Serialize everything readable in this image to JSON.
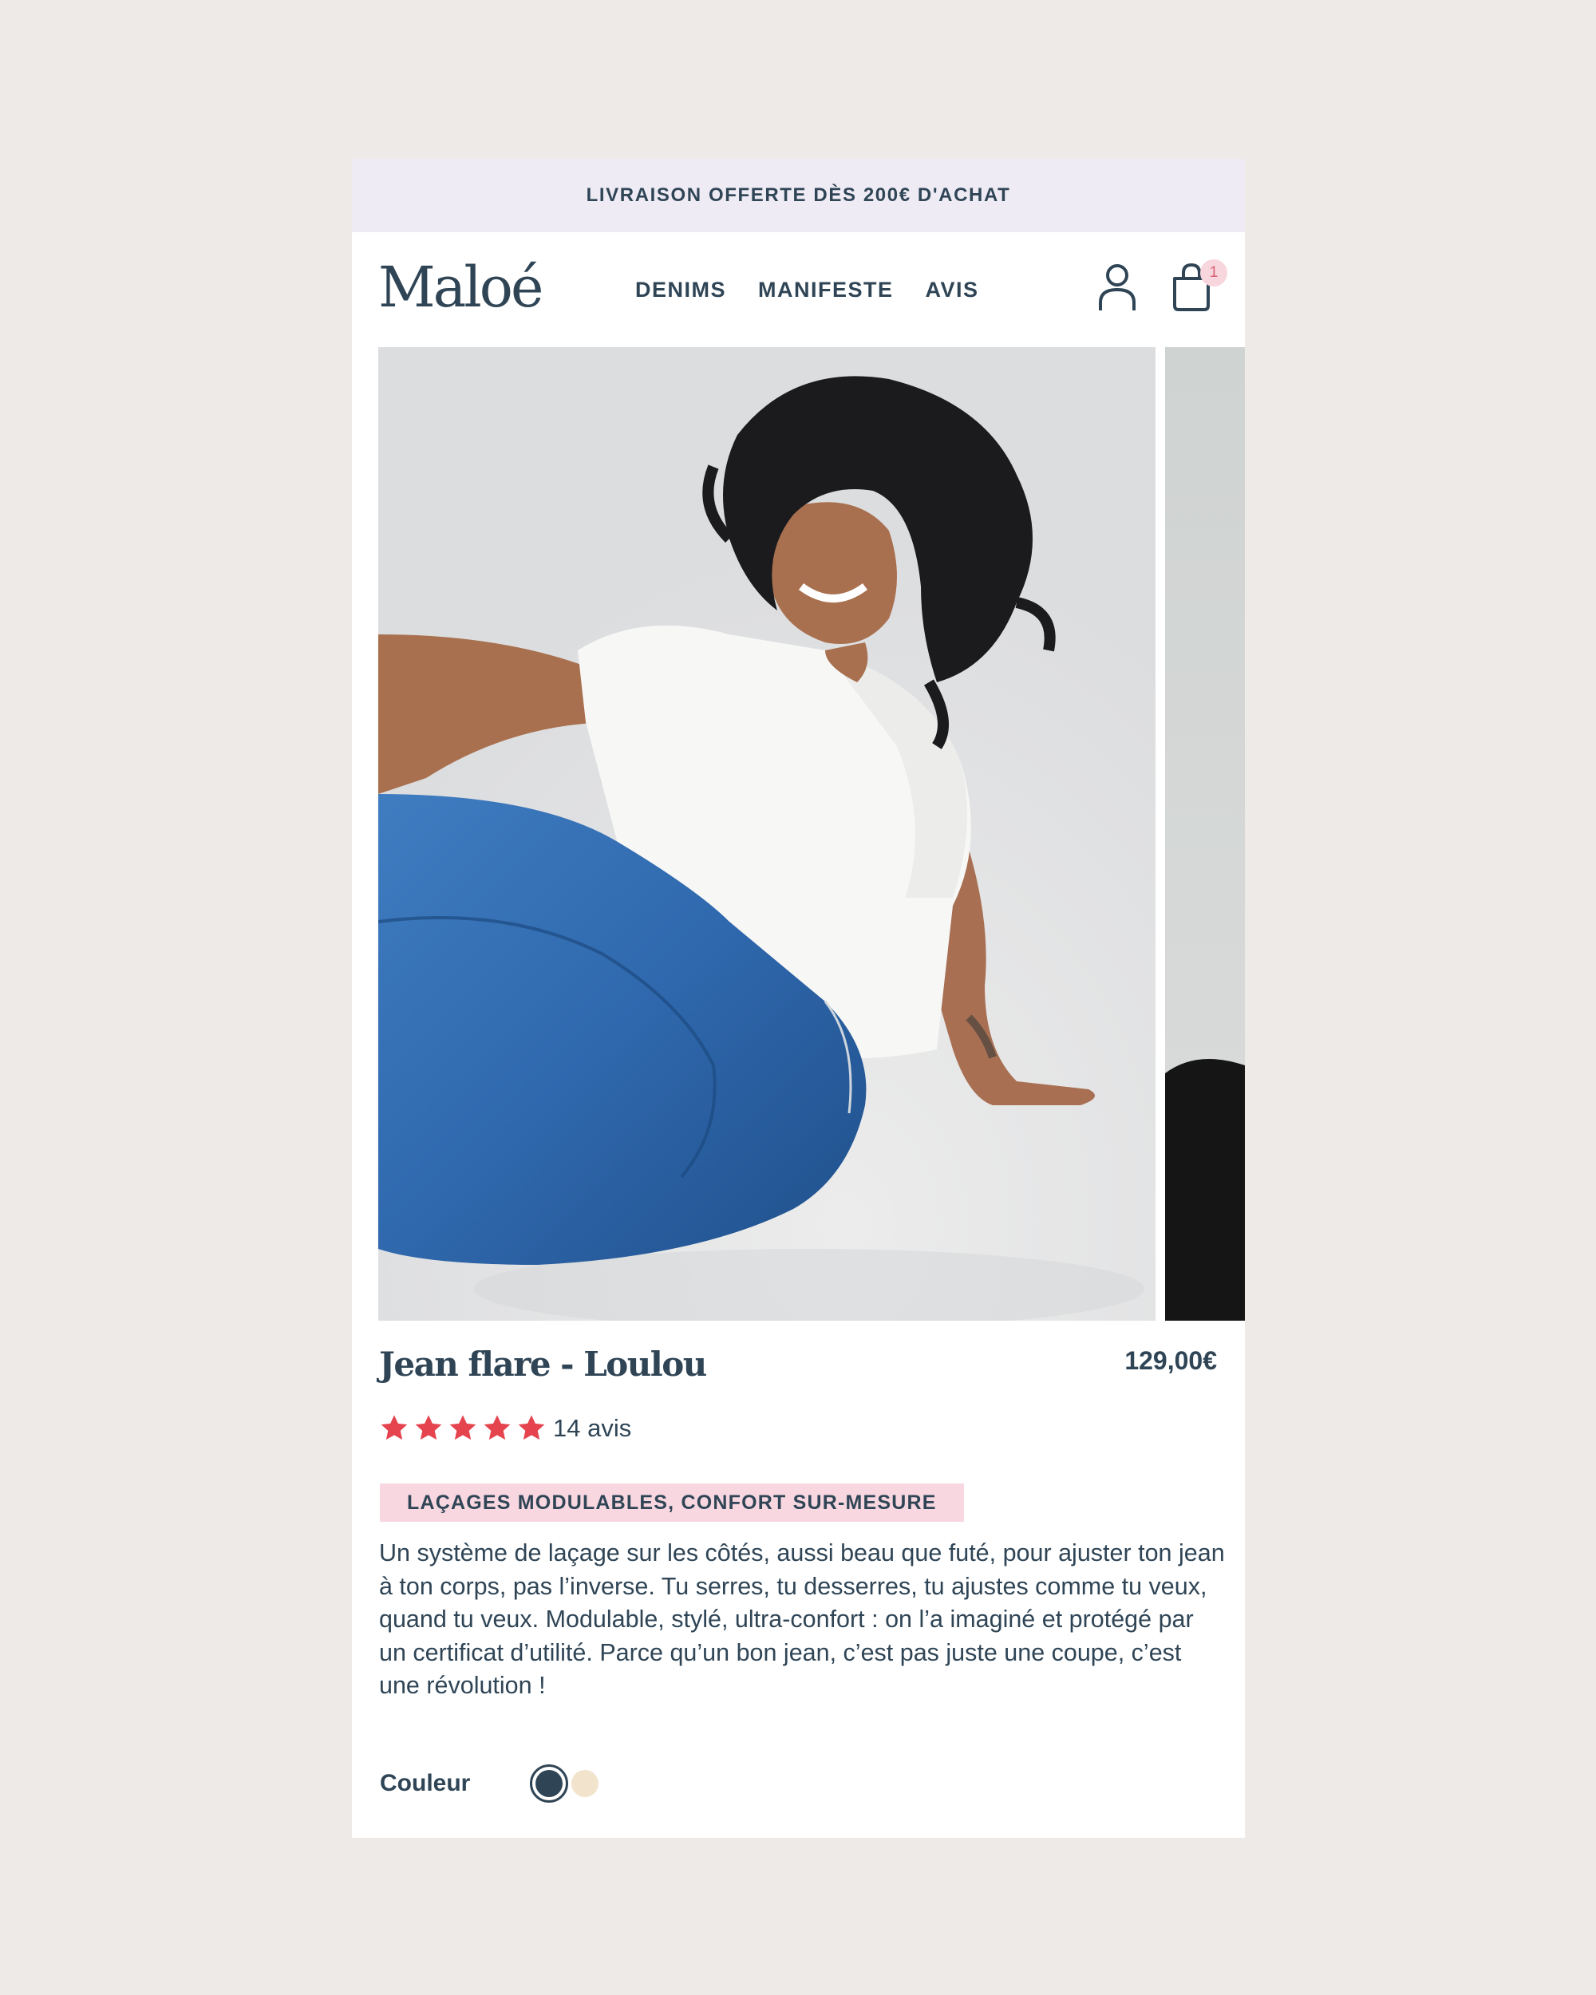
{
  "promo": {
    "text": "LIVRAISON OFFERTE DÈS 200€ D'ACHAT"
  },
  "header": {
    "logo": "Maloé",
    "nav": [
      "DENIMS",
      "MANIFESTE",
      "AVIS"
    ],
    "cart_count": "1"
  },
  "product": {
    "title": "Jean flare - Loulou",
    "price": "129,00€",
    "rating": 5,
    "reviews": "14 avis",
    "badge": "LAÇAGES MODULABLES, CONFORT SUR-MESURE",
    "description": "Un système de laçage sur les côtés, aussi beau que futé, pour ajuster ton jean à ton corps, pas l’inverse. Tu serres, tu desserres, tu ajustes comme tu veux, quand tu veux. Modulable, stylé, ultra-confort : on l’a imaginé et protégé par un certificat d’utilité. Parce qu’un bon jean, c’est pas juste une coupe, c’est une révolution !",
    "color_label": "Couleur"
  },
  "colors": {
    "navy": "#2f4556",
    "cream": "#f2e3cc",
    "star": "#e5444f",
    "badge_bg": "#f8d7e0",
    "promo_bg": "#efebf5"
  }
}
